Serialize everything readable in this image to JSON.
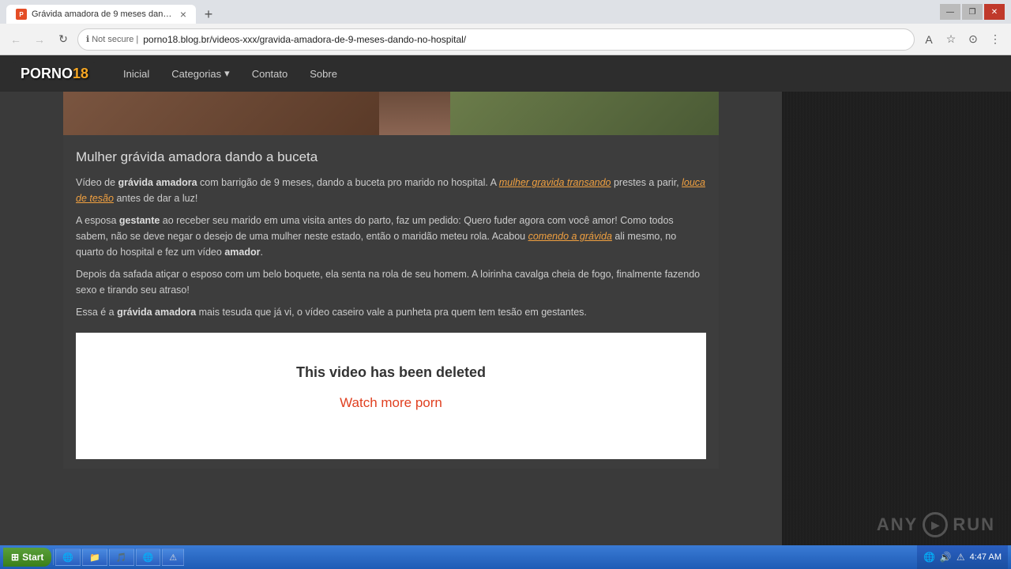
{
  "browser": {
    "tab": {
      "favicon_text": "P",
      "title": "Grávida amadora de 9 meses dando...",
      "close_label": "×"
    },
    "new_tab_label": "+",
    "window_controls": {
      "minimize": "—",
      "maximize": "❐",
      "close": "✕"
    },
    "address_bar": {
      "back_label": "←",
      "forward_label": "→",
      "refresh_label": "↻",
      "security_label": "Not secure",
      "url": "porno18.blog.br/videos-xxx/gravida-amadora-de-9-meses-dando-no-hospital/",
      "translate_icon": "A",
      "star_icon": "☆",
      "account_icon": "⊙",
      "menu_icon": "⋮"
    }
  },
  "site": {
    "logo_prefix": "PORNO",
    "logo_suffix": "18",
    "nav_items": [
      {
        "label": "Inicial"
      },
      {
        "label": "Categorias",
        "has_dropdown": true
      },
      {
        "label": "Contato"
      },
      {
        "label": "Sobre"
      }
    ]
  },
  "article": {
    "title": "Mulher grávida amadora dando a buceta",
    "paragraph1_before": "Vídeo de ",
    "paragraph1_bold1": "grávida amadora",
    "paragraph1_mid": " com barrigão de 9 meses, dando a buceta pro marido no hospital. A ",
    "paragraph1_link1": "mulher gravida transando",
    "paragraph1_after": " prestes a parir, ",
    "paragraph1_link2": "louca de tesão",
    "paragraph1_end": " antes de dar a luz!",
    "paragraph2": "A esposa ",
    "paragraph2_bold": "gestante",
    "paragraph2_mid": " ao receber seu marido em uma visita antes do parto, faz um pedido: Quero fuder agora com você amor! Como todos sabem, não se deve negar o desejo de uma mulher neste estado, então o maridão meteu rola. Acabou ",
    "paragraph2_link": "comendo a grávida",
    "paragraph2_end": " ali mesmo, no quarto do hospital e fez um vídeo ",
    "paragraph2_bold2": "amador",
    "paragraph2_final": ".",
    "paragraph3": "Depois da safada atiçar o esposo com um belo boquete, ela senta na rola de seu homem. A loirinha cavalga cheia de fogo, finalmente fazendo sexo e tirando seu atraso!",
    "paragraph4_before": "Essa é a ",
    "paragraph4_bold": "grávida amadora",
    "paragraph4_end": " mais tesuda que já vi, o vídeo caseiro vale a punheta pra quem tem tesão em gestantes."
  },
  "video_deleted": {
    "title": "This video has been deleted",
    "watch_more_label": "Watch more porn"
  },
  "watermark": {
    "text_left": "ANY",
    "text_right": "RUN"
  },
  "taskbar": {
    "start_label": "Start",
    "taskbar_buttons": [
      {
        "label": "IE",
        "icon": "🌐"
      },
      {
        "label": "📁"
      },
      {
        "label": "🎵"
      },
      {
        "label": "🌐"
      }
    ],
    "tray_icons": [
      "🔊",
      "🌐",
      "⚠"
    ],
    "time": "4:47 AM"
  }
}
